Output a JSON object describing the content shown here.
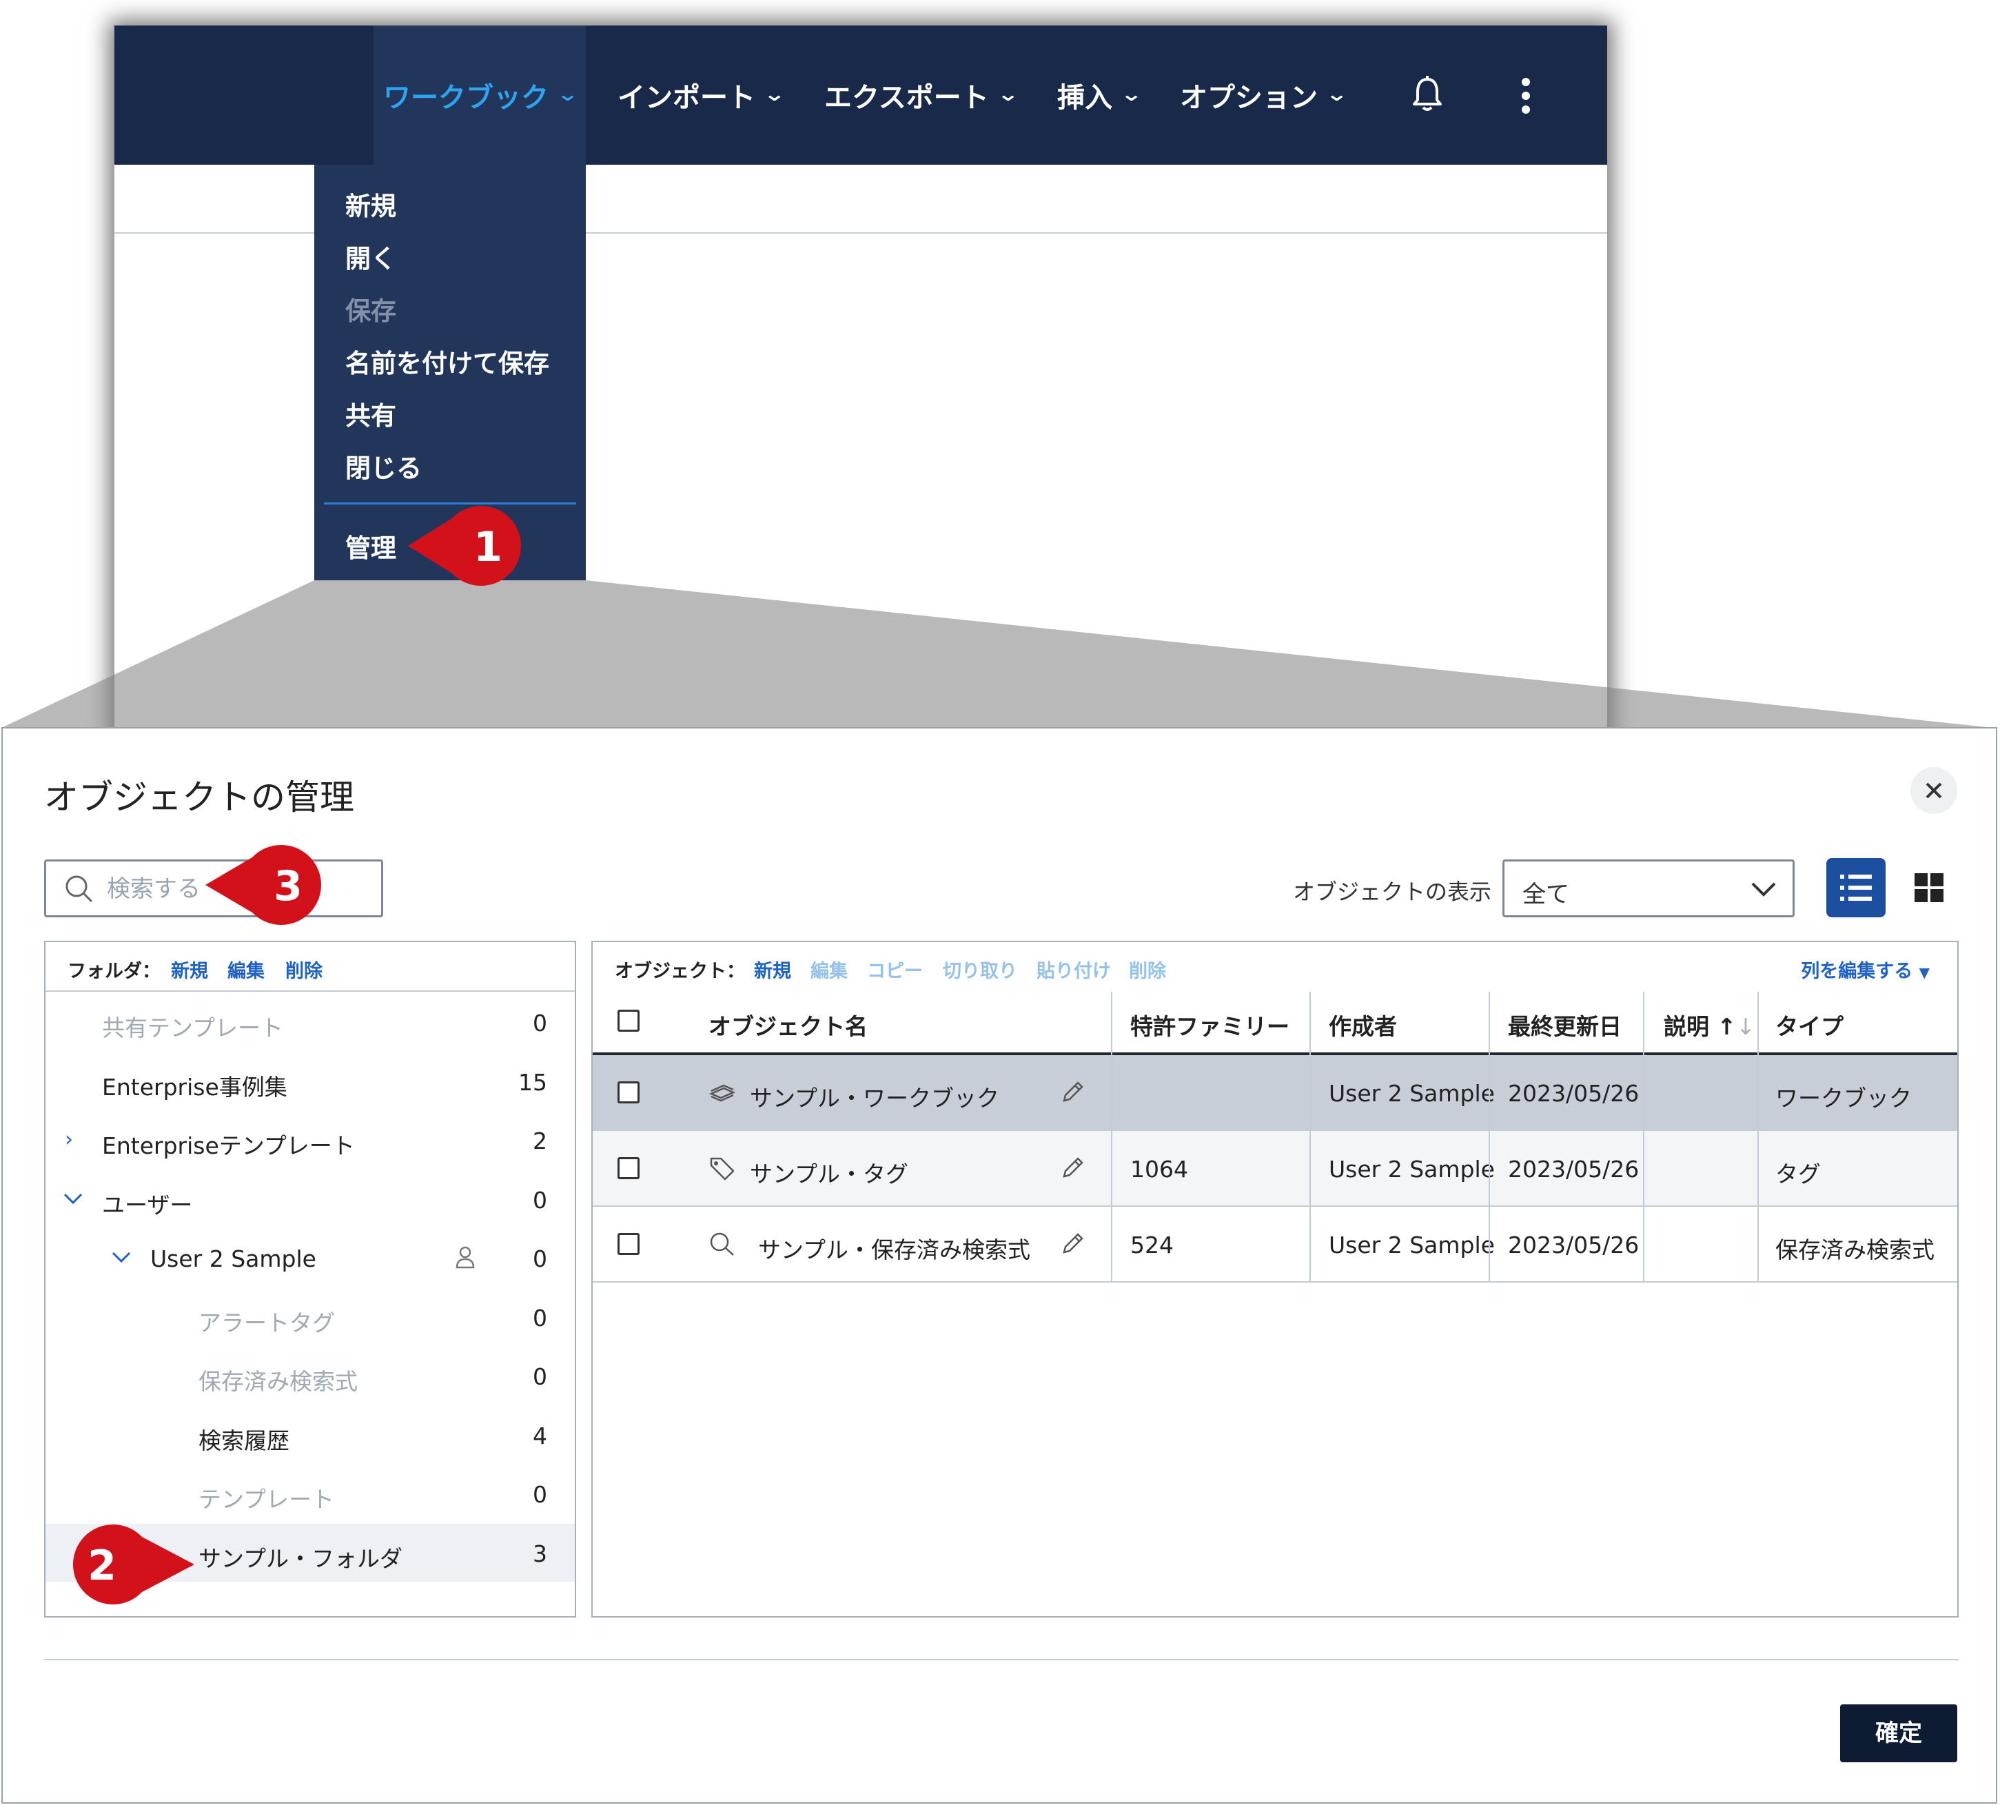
{
  "app": {
    "nav": [
      {
        "label": "ワークブック",
        "active": true
      },
      {
        "label": "インポート",
        "active": false
      },
      {
        "label": "エクスポート",
        "active": false
      },
      {
        "label": "挿入",
        "active": false
      },
      {
        "label": "オプション",
        "active": false
      }
    ],
    "icons": {
      "notifications": "bell-icon",
      "more": "kebab-icon"
    },
    "workbook_menu": {
      "items": [
        {
          "label": "新規",
          "disabled": false
        },
        {
          "label": "開く",
          "disabled": false
        },
        {
          "label": "保存",
          "disabled": true
        },
        {
          "label": "名前を付けて保存",
          "disabled": false
        },
        {
          "label": "共有",
          "disabled": false
        },
        {
          "label": "閉じる",
          "disabled": false
        }
      ],
      "manage": "管理"
    }
  },
  "callouts": [
    "1",
    "2",
    "3"
  ],
  "dialog": {
    "title": "オブジェクトの管理",
    "search_placeholder": "検索する",
    "view_label": "オブジェクトの表示",
    "view_value": "全て",
    "folder_toolbar": {
      "label": "フォルダ：",
      "new": "新規",
      "edit": "編集",
      "delete": "削除"
    },
    "folders": [
      {
        "label": "共有テンプレート",
        "count": "0",
        "disabled": true
      },
      {
        "label": "Enterprise事例集",
        "count": "15",
        "disabled": false
      },
      {
        "label": "Enterpriseテンプレート",
        "count": "2",
        "disabled": false,
        "expander": "collapsed"
      },
      {
        "label": "ユーザー",
        "count": "0",
        "disabled": false,
        "expander": "expanded"
      },
      {
        "label": "User 2 Sample",
        "count": "0",
        "disabled": false,
        "expander": "expanded",
        "icon": "user-icon"
      },
      {
        "label": "アラートタグ",
        "count": "0",
        "disabled": true
      },
      {
        "label": "保存済み検索式",
        "count": "0",
        "disabled": true
      },
      {
        "label": "検索履歴",
        "count": "4",
        "disabled": false
      },
      {
        "label": "テンプレート",
        "count": "0",
        "disabled": true
      },
      {
        "label": "サンプル・フォルダ",
        "count": "3",
        "disabled": false,
        "selected": true
      }
    ],
    "object_toolbar": {
      "label": "オブジェクト：",
      "new": "新規",
      "edit": "編集",
      "copy": "コピー",
      "cut": "切り取り",
      "paste": "貼り付け",
      "delete": "削除",
      "edit_columns": "列を編集する"
    },
    "columns": [
      "オブジェクト名",
      "特許ファミリー",
      "作成者",
      "最終更新日",
      "説明 ↑",
      "タイプ"
    ],
    "sort_indicator": "↓",
    "rows": [
      {
        "name": "サンプル・ワークブック",
        "icon": "workbook-icon",
        "family": "",
        "author": "User 2 Sample",
        "updated": "2023/05/26",
        "desc": "",
        "type": "ワークブック",
        "selected": true
      },
      {
        "name": "サンプル・タグ",
        "icon": "tag-icon",
        "family": "1064",
        "author": "User 2 Sample",
        "updated": "2023/05/26",
        "desc": "",
        "type": "タグ",
        "selected": false
      },
      {
        "name": "サンプル・保存済み検索式",
        "icon": "search-icon",
        "family": "524",
        "author": "User 2 Sample",
        "updated": "2023/05/26",
        "desc": "",
        "type": "保存済み検索式",
        "selected": false
      }
    ],
    "confirm": "確定"
  },
  "colors": {
    "nav_bg": "#19294a",
    "nav_active": "#2ea4f0",
    "menu_bg": "#22365c",
    "link": "#1f62c4",
    "primary_button": "#1c4fa0",
    "confirm_button": "#0d1b33",
    "callout": "#d3111b",
    "selected_row": "#c8ced7"
  }
}
